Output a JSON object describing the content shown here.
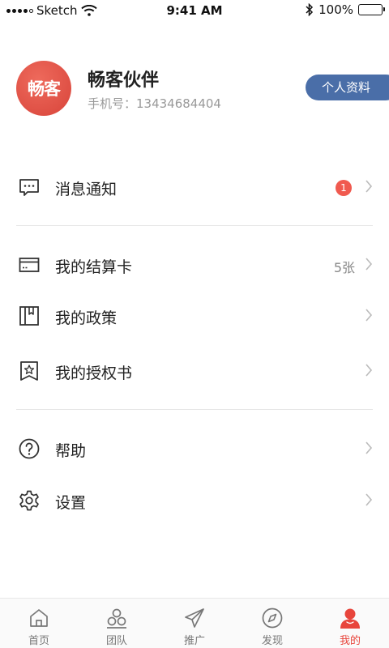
{
  "status_bar": {
    "carrier": "Sketch",
    "time": "9:41 AM",
    "battery": "100%"
  },
  "profile": {
    "avatar_text": "畅客",
    "name": "畅客伙伴",
    "phone": "手机号：13434684404",
    "profile_button": "个人资料"
  },
  "menu": {
    "messages": {
      "label": "消息通知",
      "badge": "1"
    },
    "card": {
      "label": "我的结算卡",
      "extra": "5张"
    },
    "policy": {
      "label": "我的政策"
    },
    "authorization": {
      "label": "我的授权书"
    },
    "help": {
      "label": "帮助"
    },
    "settings": {
      "label": "设置"
    }
  },
  "bottom_nav": {
    "home": "首页",
    "team": "团队",
    "promote": "推广",
    "discover": "发现",
    "mine": "我的"
  },
  "colors": {
    "accent": "#e8453c",
    "profile_button": "#4a6ea8",
    "badge": "#f05a4f"
  }
}
